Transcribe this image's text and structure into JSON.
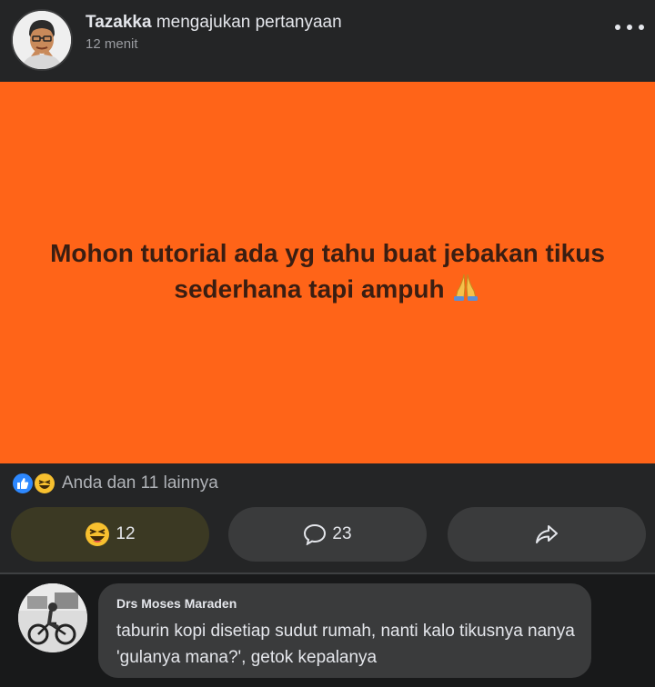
{
  "post": {
    "author": "Tazakka",
    "action": "mengajukan pertanyaan",
    "time": "12 menit",
    "text_line1": "Mohon tutorial ada yg tahu buat jebakan tikus",
    "text_line2": "sederhana tapi ampuh",
    "background_color": "#ff6418",
    "emoji": "folded-hands-icon"
  },
  "reactions": {
    "summary": "Anda dan 11 lainnya",
    "icons": [
      "like-icon",
      "haha-icon"
    ]
  },
  "actions": {
    "haha_count": "12",
    "comment_count": "23",
    "share_icon": "share-icon"
  },
  "comment": {
    "author": "Drs Moses Maraden",
    "text": "taburin kopi disetiap sudut rumah, nanti kalo tikusnya nanya 'gulanya mana?', getok kepalanya"
  }
}
